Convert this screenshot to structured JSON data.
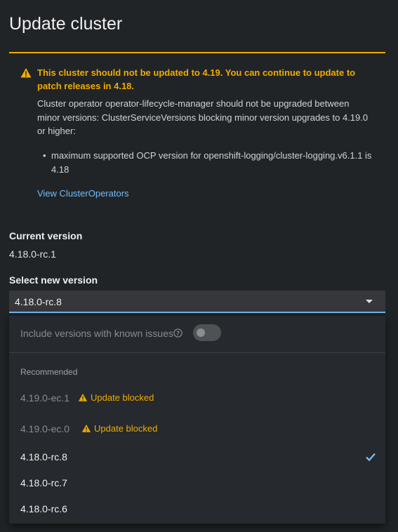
{
  "modal": {
    "title": "Update cluster"
  },
  "alert": {
    "title": "This cluster should not be updated to 4.19. You can continue to update to patch releases in 4.18.",
    "body": "Cluster operator operator-lifecycle-manager should not be upgraded between minor versions: ClusterServiceVersions blocking minor version upgrades to 4.19.0 or higher:",
    "bullets": [
      "maximum supported OCP version for openshift-logging/cluster-logging.v6.1.1 is 4.18"
    ],
    "link": "View ClusterOperators"
  },
  "current": {
    "label": "Current version",
    "value": "4.18.0-rc.1"
  },
  "select": {
    "label": "Select new version",
    "value": "4.18.0-rc.8",
    "toggle_label": "Include versions with known issues",
    "toggle_on": false,
    "group_label": "Recommended",
    "options": [
      {
        "label": "4.19.0-ec.1",
        "status": "Update blocked",
        "blocked": true,
        "selected": false
      },
      {
        "label": "4.19.0-ec.0",
        "status": "Update blocked",
        "blocked": true,
        "selected": false
      },
      {
        "label": "4.18.0-rc.8",
        "status": "",
        "blocked": false,
        "selected": true
      },
      {
        "label": "4.18.0-rc.7",
        "status": "",
        "blocked": false,
        "selected": false
      },
      {
        "label": "4.18.0-rc.6",
        "status": "",
        "blocked": false,
        "selected": false
      }
    ]
  },
  "colors": {
    "warning": "#f0ab00",
    "link": "#73bcf7",
    "background": "#212427"
  },
  "icons": {
    "alert": "warning-triangle-icon",
    "help": "question-circle-icon",
    "caret": "caret-down-icon",
    "check": "check-icon"
  }
}
